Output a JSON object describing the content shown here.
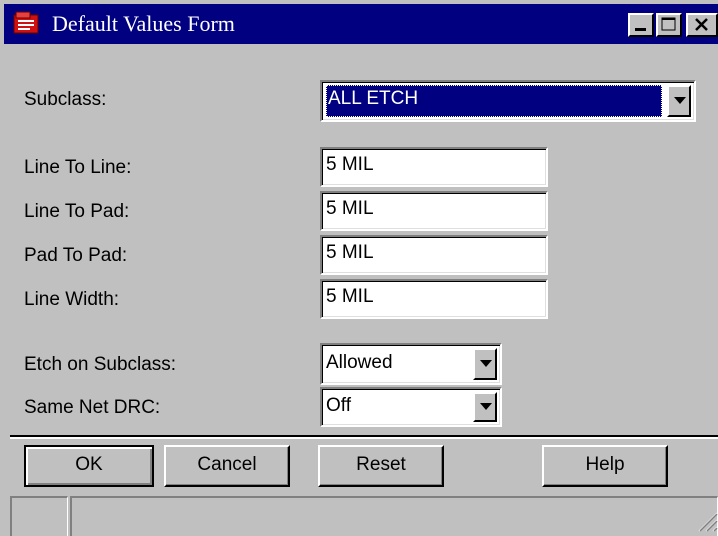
{
  "window": {
    "title": "Default Values Form"
  },
  "form": {
    "subclass": {
      "label": "Subclass:",
      "value": "ALL ETCH"
    },
    "line_to_line": {
      "label": "Line To Line:",
      "value": "5 MIL"
    },
    "line_to_pad": {
      "label": "Line To Pad:",
      "value": "5 MIL"
    },
    "pad_to_pad": {
      "label": "Pad To Pad:",
      "value": "5 MIL"
    },
    "line_width": {
      "label": "Line Width:",
      "value": "5 MIL"
    },
    "etch_on_subclass": {
      "label": "Etch on Subclass:",
      "value": "Allowed"
    },
    "same_net_drc": {
      "label": "Same Net DRC:",
      "value": "Off"
    }
  },
  "buttons": {
    "ok": "OK",
    "cancel": "Cancel",
    "reset": "Reset",
    "help": "Help"
  },
  "icons": {
    "app": "form-app-icon",
    "minimize": "minimize-icon",
    "maximize": "maximize-icon",
    "close": "close-icon",
    "dropdown": "chevron-down-icon",
    "resize": "resize-grip-icon"
  },
  "colors": {
    "titlebar": "#000080",
    "face": "#c0c0c0",
    "selection": "#000080",
    "app_icon": "#d01010"
  }
}
